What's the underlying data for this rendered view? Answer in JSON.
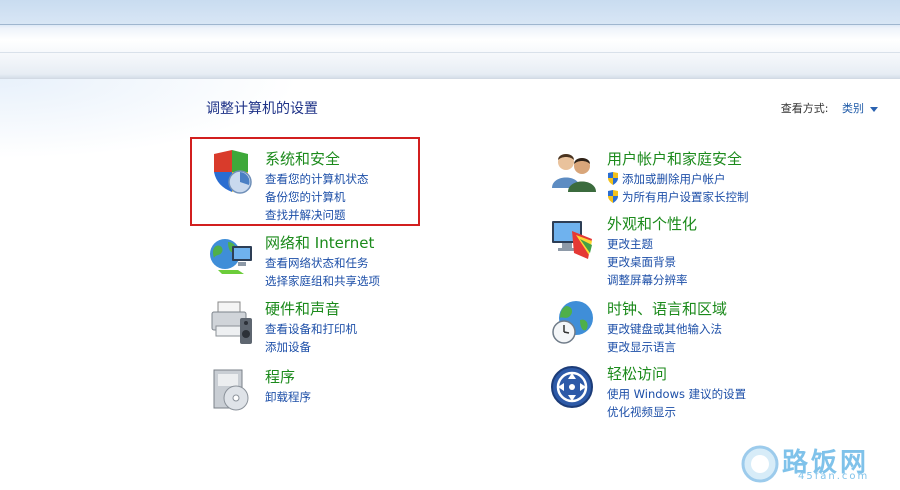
{
  "page_title": "调整计算机的设置",
  "view_by": {
    "label": "查看方式:",
    "value": "类别"
  },
  "categories_left": [
    {
      "title": "系统和安全",
      "icon": "system-security-icon",
      "links": [
        {
          "text": "查看您的计算机状态"
        },
        {
          "text": "备份您的计算机"
        },
        {
          "text": "查找并解决问题"
        }
      ]
    },
    {
      "title": "网络和 Internet",
      "icon": "network-internet-icon",
      "links": [
        {
          "text": "查看网络状态和任务"
        },
        {
          "text": "选择家庭组和共享选项"
        }
      ]
    },
    {
      "title": "硬件和声音",
      "icon": "hardware-sound-icon",
      "links": [
        {
          "text": "查看设备和打印机"
        },
        {
          "text": "添加设备"
        }
      ]
    },
    {
      "title": "程序",
      "icon": "programs-icon",
      "links": [
        {
          "text": "卸载程序"
        }
      ]
    }
  ],
  "categories_right": [
    {
      "title": "用户帐户和家庭安全",
      "icon": "user-accounts-icon",
      "links": [
        {
          "text": "添加或删除用户帐户",
          "shield": true
        },
        {
          "text": "为所有用户设置家长控制",
          "shield": true
        }
      ]
    },
    {
      "title": "外观和个性化",
      "icon": "appearance-icon",
      "links": [
        {
          "text": "更改主题"
        },
        {
          "text": "更改桌面背景"
        },
        {
          "text": "调整屏幕分辨率"
        }
      ]
    },
    {
      "title": "时钟、语言和区域",
      "icon": "clock-language-icon",
      "links": [
        {
          "text": "更改键盘或其他输入法"
        },
        {
          "text": "更改显示语言"
        }
      ]
    },
    {
      "title": "轻松访问",
      "icon": "ease-of-access-icon",
      "links": [
        {
          "text": "使用 Windows 建议的设置"
        },
        {
          "text": "优化视频显示"
        }
      ]
    }
  ],
  "watermark": {
    "name": "路饭网",
    "url": "45fan.com"
  },
  "colors": {
    "title_green": "#1b8a1b",
    "link_blue": "#1d4fa8",
    "highlight_red": "#d21f1f",
    "heading_blue": "#1e3287"
  }
}
